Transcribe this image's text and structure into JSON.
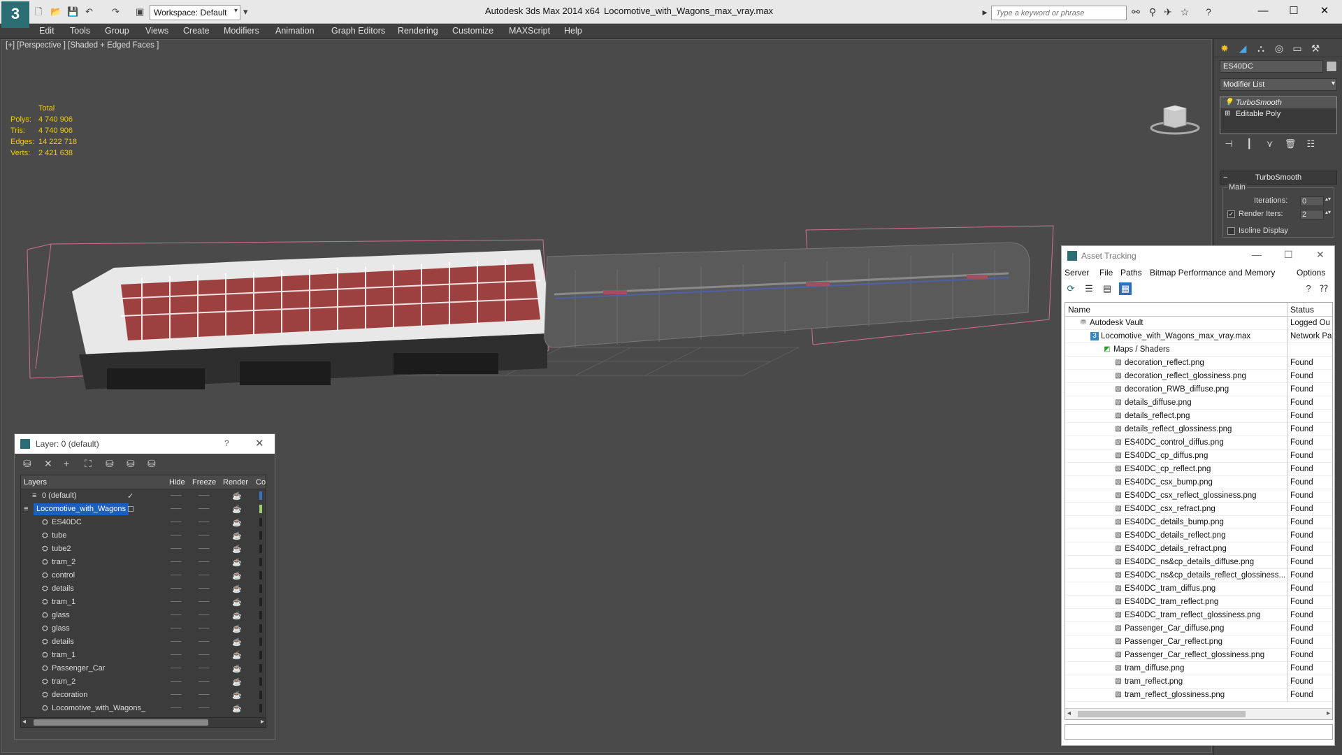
{
  "titlebar": {
    "app_title": "Autodesk 3ds Max  2014 x64",
    "file_title": "Locomotive_with_Wagons_max_vray.max",
    "workspace": "Workspace: Default",
    "search_placeholder": "Type a keyword or phrase"
  },
  "menubar": [
    "Edit",
    "Tools",
    "Group",
    "Views",
    "Create",
    "Modifiers",
    "Animation",
    "Graph Editors",
    "Rendering",
    "Customize",
    "MAXScript",
    "Help"
  ],
  "viewport": {
    "label": "[+] [Perspective ] [Shaded + Edged Faces ]",
    "stats": {
      "header": "Total",
      "polys_label": "Polys:",
      "polys": "4 740 906",
      "tris_label": "Tris:",
      "tris": "4 740 906",
      "edges_label": "Edges:",
      "edges": "14 222 718",
      "verts_label": "Verts:",
      "verts": "2 421 638"
    }
  },
  "command_panel": {
    "object_name": "ES40DC",
    "modifier_list": "Modifier List",
    "stack": [
      "TurboSmooth",
      "Editable Poly"
    ],
    "rollout_title": "TurboSmooth",
    "group_title": "Main",
    "iterations_label": "Iterations:",
    "iterations_value": "0",
    "render_iters_label": "Render Iters:",
    "render_iters_value": "2",
    "isoline_label": "Isoline Display"
  },
  "layer_window": {
    "title": "Layer: 0 (default)",
    "help": "?",
    "columns": {
      "layers": "Layers",
      "hide": "Hide",
      "freeze": "Freeze",
      "render": "Render",
      "color": "Co"
    },
    "rows": [
      {
        "name": "0 (default)"
      },
      {
        "name": "Locomotive_with_Wagons"
      },
      {
        "name": "ES40DC"
      },
      {
        "name": "tube"
      },
      {
        "name": "tube2"
      },
      {
        "name": "tram_2"
      },
      {
        "name": "control"
      },
      {
        "name": "details"
      },
      {
        "name": "tram_1"
      },
      {
        "name": "glass"
      },
      {
        "name": "glass"
      },
      {
        "name": "details"
      },
      {
        "name": "tram_1"
      },
      {
        "name": "Passenger_Car"
      },
      {
        "name": "tram_2"
      },
      {
        "name": "decoration"
      },
      {
        "name": "Locomotive_with_Wagons_"
      }
    ]
  },
  "asset_window": {
    "title": "Asset Tracking",
    "menu": [
      "Server",
      "File",
      "Paths",
      "Bitmap Performance and Memory",
      "Options"
    ],
    "columns": {
      "name": "Name",
      "status": "Status"
    },
    "rows": [
      {
        "name": "Autodesk Vault",
        "status": "Logged Ou"
      },
      {
        "name": "Locomotive_with_Wagons_max_vray.max",
        "status": "Network Pa"
      },
      {
        "name": "Maps / Shaders",
        "status": ""
      },
      {
        "name": "decoration_reflect.png",
        "status": "Found"
      },
      {
        "name": "decoration_reflect_glossiness.png",
        "status": "Found"
      },
      {
        "name": "decoration_RWB_diffuse.png",
        "status": "Found"
      },
      {
        "name": "details_diffuse.png",
        "status": "Found"
      },
      {
        "name": "details_reflect.png",
        "status": "Found"
      },
      {
        "name": "details_reflect_glossiness.png",
        "status": "Found"
      },
      {
        "name": "ES40DC_control_diffus.png",
        "status": "Found"
      },
      {
        "name": "ES40DC_cp_diffus.png",
        "status": "Found"
      },
      {
        "name": "ES40DC_cp_reflect.png",
        "status": "Found"
      },
      {
        "name": "ES40DC_csx_bump.png",
        "status": "Found"
      },
      {
        "name": "ES40DC_csx_reflect_glossiness.png",
        "status": "Found"
      },
      {
        "name": "ES40DC_csx_refract.png",
        "status": "Found"
      },
      {
        "name": "ES40DC_details_bump.png",
        "status": "Found"
      },
      {
        "name": "ES40DC_details_reflect.png",
        "status": "Found"
      },
      {
        "name": "ES40DC_details_refract.png",
        "status": "Found"
      },
      {
        "name": "ES40DC_ns&cp_details_diffuse.png",
        "status": "Found"
      },
      {
        "name": "ES40DC_ns&cp_details_reflect_glossiness...",
        "status": "Found"
      },
      {
        "name": "ES40DC_tram_diffus.png",
        "status": "Found"
      },
      {
        "name": "ES40DC_tram_reflect.png",
        "status": "Found"
      },
      {
        "name": "ES40DC_tram_reflect_glossiness.png",
        "status": "Found"
      },
      {
        "name": "Passenger_Car_diffuse.png",
        "status": "Found"
      },
      {
        "name": "Passenger_Car_reflect.png",
        "status": "Found"
      },
      {
        "name": "Passenger_Car_reflect_glossiness.png",
        "status": "Found"
      },
      {
        "name": "tram_diffuse.png",
        "status": "Found"
      },
      {
        "name": "tram_reflect.png",
        "status": "Found"
      },
      {
        "name": "tram_reflect_glossiness.png",
        "status": "Found"
      }
    ]
  }
}
